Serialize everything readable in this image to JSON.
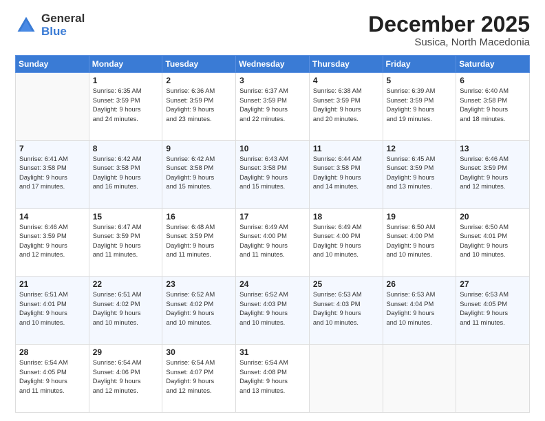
{
  "logo": {
    "general": "General",
    "blue": "Blue"
  },
  "header": {
    "month": "December 2025",
    "location": "Susica, North Macedonia"
  },
  "days_of_week": [
    "Sunday",
    "Monday",
    "Tuesday",
    "Wednesday",
    "Thursday",
    "Friday",
    "Saturday"
  ],
  "weeks": [
    [
      {
        "day": "",
        "info": ""
      },
      {
        "day": "1",
        "info": "Sunrise: 6:35 AM\nSunset: 3:59 PM\nDaylight: 9 hours\nand 24 minutes."
      },
      {
        "day": "2",
        "info": "Sunrise: 6:36 AM\nSunset: 3:59 PM\nDaylight: 9 hours\nand 23 minutes."
      },
      {
        "day": "3",
        "info": "Sunrise: 6:37 AM\nSunset: 3:59 PM\nDaylight: 9 hours\nand 22 minutes."
      },
      {
        "day": "4",
        "info": "Sunrise: 6:38 AM\nSunset: 3:59 PM\nDaylight: 9 hours\nand 20 minutes."
      },
      {
        "day": "5",
        "info": "Sunrise: 6:39 AM\nSunset: 3:59 PM\nDaylight: 9 hours\nand 19 minutes."
      },
      {
        "day": "6",
        "info": "Sunrise: 6:40 AM\nSunset: 3:58 PM\nDaylight: 9 hours\nand 18 minutes."
      }
    ],
    [
      {
        "day": "7",
        "info": "Sunrise: 6:41 AM\nSunset: 3:58 PM\nDaylight: 9 hours\nand 17 minutes."
      },
      {
        "day": "8",
        "info": "Sunrise: 6:42 AM\nSunset: 3:58 PM\nDaylight: 9 hours\nand 16 minutes."
      },
      {
        "day": "9",
        "info": "Sunrise: 6:42 AM\nSunset: 3:58 PM\nDaylight: 9 hours\nand 15 minutes."
      },
      {
        "day": "10",
        "info": "Sunrise: 6:43 AM\nSunset: 3:58 PM\nDaylight: 9 hours\nand 15 minutes."
      },
      {
        "day": "11",
        "info": "Sunrise: 6:44 AM\nSunset: 3:58 PM\nDaylight: 9 hours\nand 14 minutes."
      },
      {
        "day": "12",
        "info": "Sunrise: 6:45 AM\nSunset: 3:59 PM\nDaylight: 9 hours\nand 13 minutes."
      },
      {
        "day": "13",
        "info": "Sunrise: 6:46 AM\nSunset: 3:59 PM\nDaylight: 9 hours\nand 12 minutes."
      }
    ],
    [
      {
        "day": "14",
        "info": "Sunrise: 6:46 AM\nSunset: 3:59 PM\nDaylight: 9 hours\nand 12 minutes."
      },
      {
        "day": "15",
        "info": "Sunrise: 6:47 AM\nSunset: 3:59 PM\nDaylight: 9 hours\nand 11 minutes."
      },
      {
        "day": "16",
        "info": "Sunrise: 6:48 AM\nSunset: 3:59 PM\nDaylight: 9 hours\nand 11 minutes."
      },
      {
        "day": "17",
        "info": "Sunrise: 6:49 AM\nSunset: 4:00 PM\nDaylight: 9 hours\nand 11 minutes."
      },
      {
        "day": "18",
        "info": "Sunrise: 6:49 AM\nSunset: 4:00 PM\nDaylight: 9 hours\nand 10 minutes."
      },
      {
        "day": "19",
        "info": "Sunrise: 6:50 AM\nSunset: 4:00 PM\nDaylight: 9 hours\nand 10 minutes."
      },
      {
        "day": "20",
        "info": "Sunrise: 6:50 AM\nSunset: 4:01 PM\nDaylight: 9 hours\nand 10 minutes."
      }
    ],
    [
      {
        "day": "21",
        "info": "Sunrise: 6:51 AM\nSunset: 4:01 PM\nDaylight: 9 hours\nand 10 minutes."
      },
      {
        "day": "22",
        "info": "Sunrise: 6:51 AM\nSunset: 4:02 PM\nDaylight: 9 hours\nand 10 minutes."
      },
      {
        "day": "23",
        "info": "Sunrise: 6:52 AM\nSunset: 4:02 PM\nDaylight: 9 hours\nand 10 minutes."
      },
      {
        "day": "24",
        "info": "Sunrise: 6:52 AM\nSunset: 4:03 PM\nDaylight: 9 hours\nand 10 minutes."
      },
      {
        "day": "25",
        "info": "Sunrise: 6:53 AM\nSunset: 4:03 PM\nDaylight: 9 hours\nand 10 minutes."
      },
      {
        "day": "26",
        "info": "Sunrise: 6:53 AM\nSunset: 4:04 PM\nDaylight: 9 hours\nand 10 minutes."
      },
      {
        "day": "27",
        "info": "Sunrise: 6:53 AM\nSunset: 4:05 PM\nDaylight: 9 hours\nand 11 minutes."
      }
    ],
    [
      {
        "day": "28",
        "info": "Sunrise: 6:54 AM\nSunset: 4:05 PM\nDaylight: 9 hours\nand 11 minutes."
      },
      {
        "day": "29",
        "info": "Sunrise: 6:54 AM\nSunset: 4:06 PM\nDaylight: 9 hours\nand 12 minutes."
      },
      {
        "day": "30",
        "info": "Sunrise: 6:54 AM\nSunset: 4:07 PM\nDaylight: 9 hours\nand 12 minutes."
      },
      {
        "day": "31",
        "info": "Sunrise: 6:54 AM\nSunset: 4:08 PM\nDaylight: 9 hours\nand 13 minutes."
      },
      {
        "day": "",
        "info": ""
      },
      {
        "day": "",
        "info": ""
      },
      {
        "day": "",
        "info": ""
      }
    ]
  ]
}
